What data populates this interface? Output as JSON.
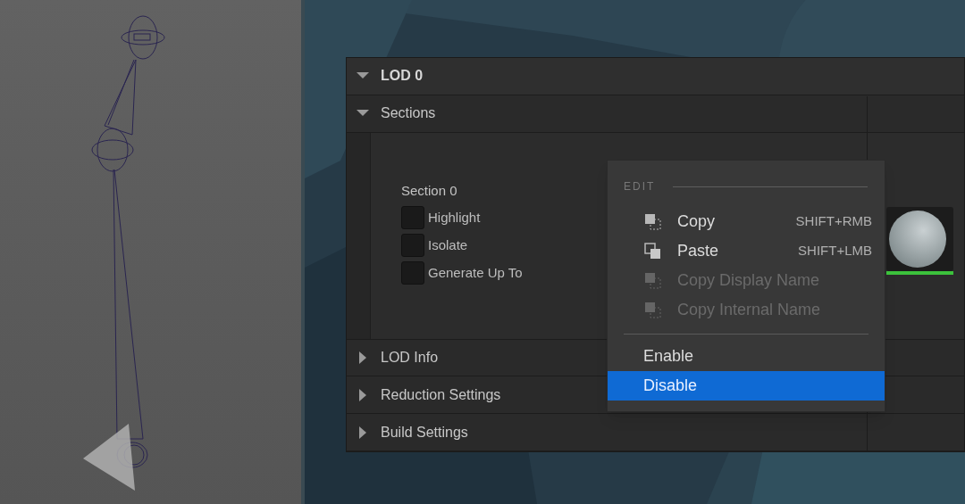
{
  "details_panel": {
    "categories": [
      {
        "label": "LOD 0",
        "expanded": true,
        "children": [
          {
            "label": "Sections",
            "expanded": true,
            "section": {
              "title": "Section 0",
              "options": [
                {
                  "label": "Highlight",
                  "checked": false
                },
                {
                  "label": "Isolate",
                  "checked": false
                },
                {
                  "label": "Generate Up To",
                  "checked": false
                }
              ]
            }
          },
          {
            "label": "LOD Info",
            "expanded": false
          },
          {
            "label": "Reduction Settings",
            "expanded": false
          },
          {
            "label": "Build Settings",
            "expanded": false
          }
        ]
      }
    ]
  },
  "context_menu": {
    "sections": [
      {
        "heading": "EDIT",
        "items": [
          {
            "kind": "copy",
            "label": "Copy",
            "shortcut": "SHIFT+RMB",
            "disabled": false,
            "selected": false
          },
          {
            "kind": "paste",
            "label": "Paste",
            "shortcut": "SHIFT+LMB",
            "disabled": false,
            "selected": false
          },
          {
            "kind": "copy",
            "label": "Copy Display Name",
            "disabled": true,
            "selected": false
          },
          {
            "kind": "copy",
            "label": "Copy Internal Name",
            "disabled": true,
            "selected": false
          }
        ]
      },
      {
        "items": [
          {
            "kind": "plain",
            "label": "Enable",
            "disabled": false,
            "selected": false
          },
          {
            "kind": "plain",
            "label": "Disable",
            "disabled": false,
            "selected": true
          }
        ]
      }
    ]
  }
}
